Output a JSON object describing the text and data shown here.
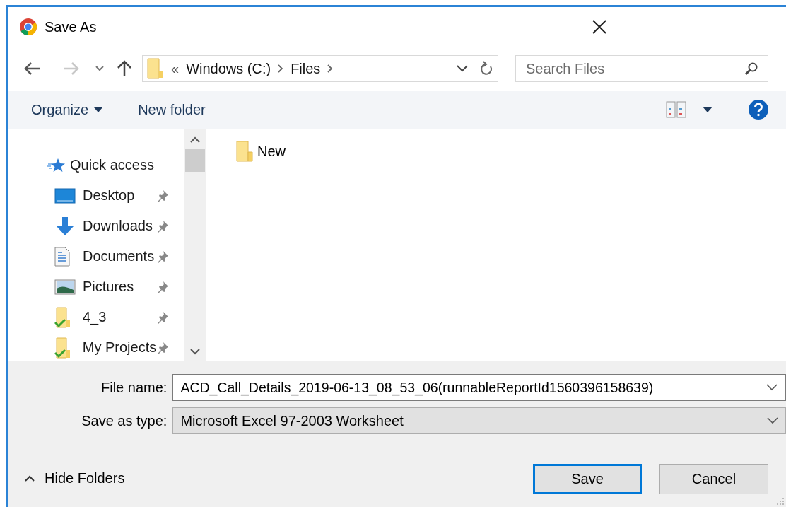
{
  "window": {
    "title": "Save As"
  },
  "history": {
    "back": {
      "disabled": false
    },
    "forward": {
      "disabled": true
    }
  },
  "address": {
    "overflow_mark": "«",
    "segments": [
      "Windows (C:)",
      "Files"
    ]
  },
  "search": {
    "placeholder": "Search Files"
  },
  "toolbar": {
    "organize": "Organize",
    "new_folder": "New folder"
  },
  "sidebar": {
    "items": [
      {
        "label": "Quick access",
        "kind": "quick-access",
        "pinned": false
      },
      {
        "label": "Desktop",
        "kind": "desktop",
        "pinned": true
      },
      {
        "label": "Downloads",
        "kind": "downloads",
        "pinned": true
      },
      {
        "label": "Documents",
        "kind": "documents",
        "pinned": true
      },
      {
        "label": "Pictures",
        "kind": "pictures",
        "pinned": true
      },
      {
        "label": "4_3",
        "kind": "synced-folder",
        "pinned": true
      },
      {
        "label": "My Projects",
        "kind": "synced-folder",
        "pinned": true
      }
    ]
  },
  "files": [
    {
      "name": "New",
      "kind": "folder"
    }
  ],
  "file_name": {
    "label": "File name:",
    "value": "ACD_Call_Details_2019-06-13_08_53_06(runnableReportId1560396158639)"
  },
  "save_type": {
    "label": "Save as type:",
    "value": "Microsoft Excel 97-2003 Worksheet"
  },
  "hide_folders": {
    "label": "Hide Folders"
  },
  "buttons": [
    {
      "label": "Save",
      "default": true
    },
    {
      "label": "Cancel",
      "default": false
    }
  ]
}
